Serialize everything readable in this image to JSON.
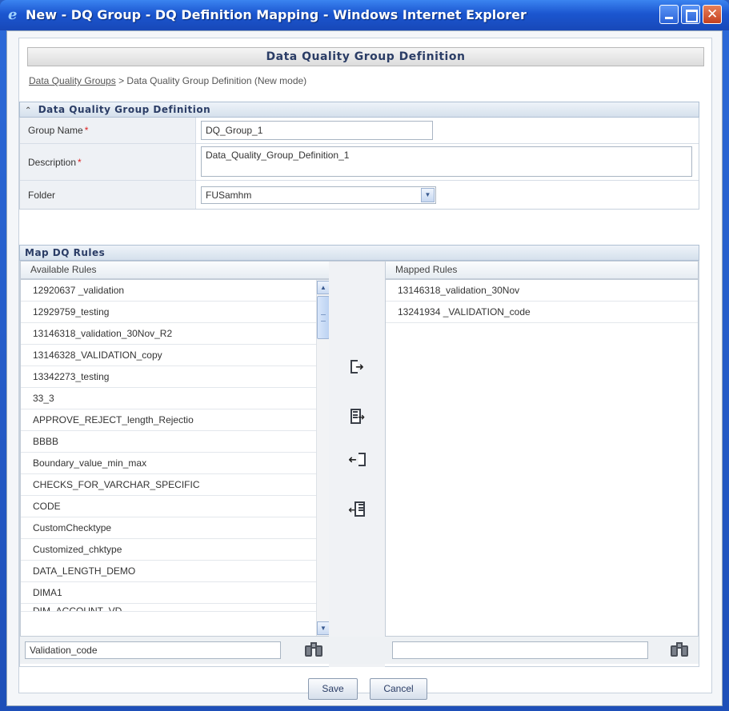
{
  "window": {
    "title": "New - DQ Group - DQ Definition Mapping - Windows Internet Explorer"
  },
  "page": {
    "header": "Data Quality Group Definition",
    "breadcrumb": {
      "link": "Data Quality Groups",
      "separator": ">",
      "current": "Data Quality Group Definition (New mode)"
    }
  },
  "definition": {
    "section_title": "Data Quality Group Definition",
    "group_name_label": "Group Name",
    "group_name_value": "DQ_Group_1",
    "description_label": "Description",
    "description_value": "Data_Quality_Group_Definition_1",
    "folder_label": "Folder",
    "folder_value": "FUSamhm",
    "required_marker": "*"
  },
  "mapping": {
    "section_title": "Map DQ Rules",
    "available_header": "Available Rules",
    "mapped_header": "Mapped Rules",
    "available_rules": [
      "12920637 _validation",
      "12929759_testing",
      "13146318_validation_30Nov_R2",
      "13146328_VALIDATION_copy",
      "13342273_testing",
      "33_3",
      "APPROVE_REJECT_length_Rejectio",
      "BBBB",
      "Boundary_value_min_max",
      "CHECKS_FOR_VARCHAR_SPECIFIC",
      "CODE",
      "CustomChecktype",
      "Customized_chktype",
      "DATA_LENGTH_DEMO",
      "DIMA1",
      "DIM_ACCOUNT_VD"
    ],
    "mapped_rules": [
      "13146318_validation_30Nov",
      "13241934 _VALIDATION_code"
    ],
    "available_search_value": "Validation_code",
    "mapped_search_value": ""
  },
  "buttons": {
    "save": "Save",
    "cancel": "Cancel"
  },
  "colors": {
    "titlebar": "#1b56d0",
    "header_text": "#2b3d66",
    "required": "#dd2222"
  }
}
